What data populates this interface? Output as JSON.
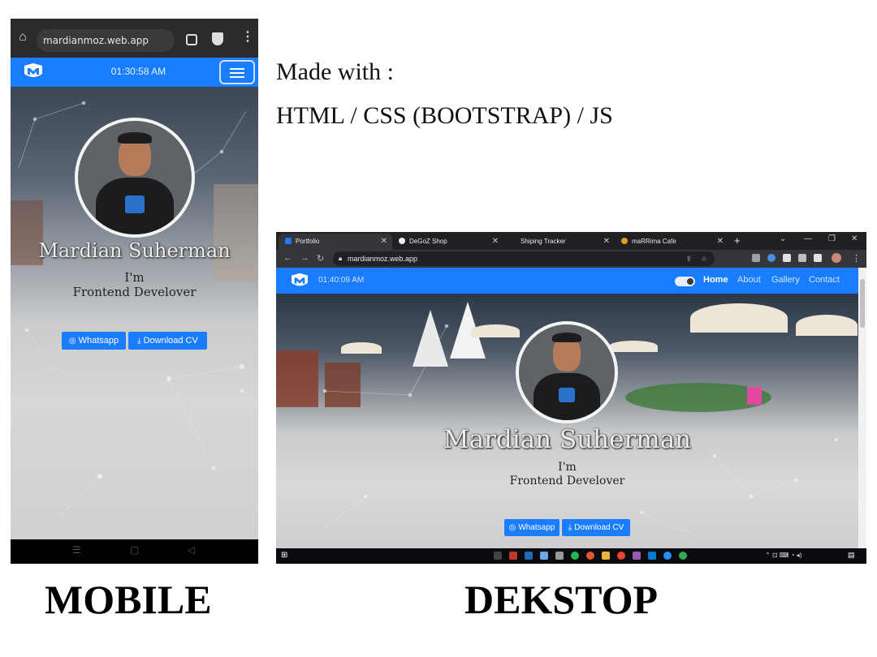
{
  "mobile": {
    "url": "mardianmoz.web.app",
    "clock": "01:30:58 AM",
    "name": "Mardian Suherman",
    "im": "I'm",
    "role": "Frontend Develover",
    "whatsapp_label": "Whatsapp",
    "download_label": "Download CV",
    "caption": "MOBILE"
  },
  "made_with": {
    "line1": "Made with :",
    "line2": "HTML / CSS (BOOTSTRAP) / JS"
  },
  "desktop": {
    "tabs": [
      {
        "label": "Portfolio"
      },
      {
        "label": "DeGoZ Shop"
      },
      {
        "label": "Shiping Tracker"
      },
      {
        "label": "maRRima Cafe"
      }
    ],
    "url": "mardianmoz.web.app",
    "clock": "01:40:09 AM",
    "nav": {
      "home": "Home",
      "about": "About",
      "gallery": "Gallery",
      "contact": "Contact"
    },
    "name": "Mardian Suherman",
    "im": "I'm",
    "role": "Frontend Develover",
    "whatsapp_label": "Whatsapp",
    "download_label": "Download CV",
    "caption": "DEKSTOP"
  },
  "colors": {
    "brand_blue": "#1a7dff",
    "browser_dark": "#202124",
    "text_dark": "#222222"
  },
  "icons": [
    "home-icon",
    "tabs-icon",
    "shield-icon",
    "menu-dots-icon",
    "logo-icon",
    "hamburger-icon",
    "whatsapp-icon",
    "download-icon",
    "back-icon",
    "forward-icon",
    "reload-icon",
    "lock-icon",
    "share-icon",
    "star-icon",
    "windows-icon"
  ]
}
